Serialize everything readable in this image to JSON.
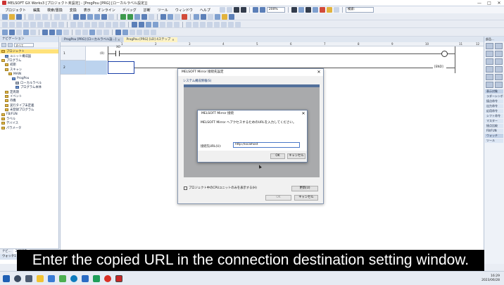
{
  "window": {
    "title": "MELSOFT GX Works3 [プロジェクト未設定] - [ProgPou [PRG] [ローカルラベル設定]]",
    "controls": {
      "minimize": "—",
      "maximize": "□",
      "close": "✕"
    }
  },
  "menu": {
    "items": [
      "プロジェクト",
      "編集",
      "検索/置換",
      "変換",
      "表示",
      "オンライン",
      "デバッグ",
      "診断",
      "ツール",
      "ウィンドウ",
      "ヘルプ"
    ]
  },
  "toolbar": {
    "zoom": "200%",
    "search_label": "検索:"
  },
  "left_panel": {
    "header": "ナビゲーション",
    "filter": "すべて",
    "tree": [
      {
        "label": "プロジェクト",
        "icon": "project-folder-icon",
        "level": 0,
        "selected": true
      },
      {
        "label": "ユニット構成図",
        "icon": "unit-config-icon",
        "level": 1
      },
      {
        "label": "プログラム",
        "icon": "program-folder-icon",
        "level": 0
      },
      {
        "label": "初期",
        "icon": "folder-icon",
        "level": 1
      },
      {
        "label": "スキャン",
        "icon": "folder-icon",
        "level": 1
      },
      {
        "label": "MAIN",
        "icon": "folder-icon",
        "level": 2
      },
      {
        "label": "ProgPou",
        "icon": "program-icon",
        "level": 3
      },
      {
        "label": "ローカルラベル",
        "icon": "label-icon",
        "level": 4
      },
      {
        "label": "プログラム本体",
        "icon": "program-body-icon",
        "level": 4
      },
      {
        "label": "定周期",
        "icon": "folder-icon",
        "level": 1
      },
      {
        "label": "イベント",
        "icon": "folder-icon",
        "level": 1
      },
      {
        "label": "待機",
        "icon": "folder-icon",
        "level": 1
      },
      {
        "label": "実行タイプ未定義",
        "icon": "folder-icon",
        "level": 1
      },
      {
        "label": "未登録プログラム",
        "icon": "folder-icon",
        "level": 1
      },
      {
        "label": "FB/FUN",
        "icon": "fb-folder-icon",
        "level": 0
      },
      {
        "label": "ラベル",
        "icon": "label-folder-icon",
        "level": 0
      },
      {
        "label": "デバイス",
        "icon": "device-folder-icon",
        "level": 0
      },
      {
        "label": "パラメータ",
        "icon": "parameter-folder-icon",
        "level": 0
      }
    ],
    "bottom_tabs": [
      "ナビ...",
      "2 接続先"
    ],
    "footer_header": "ウォッチ1"
  },
  "editor": {
    "tabs": [
      {
        "label": "ProgPou [PRG] [ローカルラベル設...]",
        "active": false
      },
      {
        "label": "ProgPou [PRG] [LD] 4ステップ",
        "active": true
      }
    ],
    "ruler": [
      "1",
      "2",
      "3",
      "4",
      "5",
      "6",
      "7",
      "8",
      "9",
      "10",
      "11",
      "12"
    ],
    "rungs": [
      {
        "number": "1",
        "step": "(0)",
        "contact_label": "X0",
        "coil_label": ""
      },
      {
        "number": "2",
        "step": "(2)",
        "end_label": "END"
      }
    ]
  },
  "right_panel": {
    "header": "部品...",
    "list_header": "表示対象",
    "items": [
      "ラダーシンボル",
      "接点命令",
      "出力命令",
      "応用命令",
      "シフト命令",
      "マスター",
      "接点比較",
      "FB/FUN",
      "ウォッチ",
      "ツール"
    ]
  },
  "outer_dialog": {
    "title": "MELSOFT Mirror 接続先設定",
    "section_label": "システム構成情報(S)",
    "checkbox_label": "プロジェクト中のCPUユニットのみを表示する(H)",
    "update_button": "更新(U)",
    "ok_button": "OK",
    "cancel_button": "キャンセル"
  },
  "inner_dialog": {
    "title": "MELSOFT Mirror 接続",
    "message": "MELSOFT Mirror へアクセスするためのURLを入力してください。",
    "url_label": "接続先URL(U):",
    "url_value": "http://localhost",
    "ok_button": "OK",
    "cancel_button": "キャンセル"
  },
  "caption": "Enter the copied URL in the connection destination setting window.",
  "taskbar": {
    "time": "16:29",
    "date": "2023/06/28"
  },
  "colors": {
    "caption_bg": "#000000",
    "caption_fg": "#ffffff",
    "selection": "#ffe27a",
    "accent": "#1a3fa8"
  }
}
